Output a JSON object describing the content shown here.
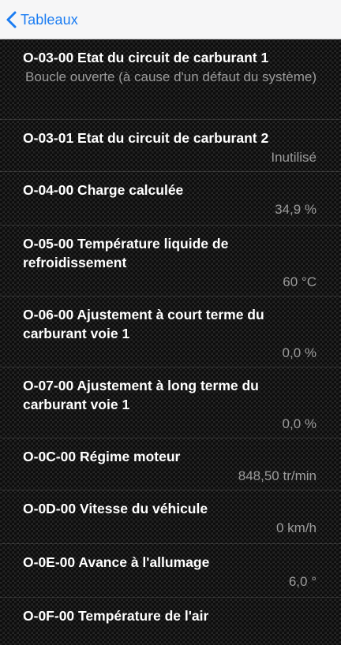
{
  "navbar": {
    "back_label": "Tableaux"
  },
  "rows": [
    {
      "title": "O-03-00 Etat du circuit de carburant 1",
      "value": "Boucle ouverte (à cause d'un défaut du système)"
    },
    {
      "title": "O-03-01 Etat du circuit de carburant 2",
      "value": "Inutilisé"
    },
    {
      "title": "O-04-00 Charge calculée",
      "value": "34,9 %"
    },
    {
      "title": "O-05-00 Température liquide de refroidissement",
      "value": "60 °C"
    },
    {
      "title": "O-06-00 Ajustement à court terme du carburant voie 1",
      "value": "0,0 %"
    },
    {
      "title": "O-07-00 Ajustement à long terme du carburant voie 1",
      "value": "0,0 %"
    },
    {
      "title": "O-0C-00 Régime moteur",
      "value": "848,50 tr/min"
    },
    {
      "title": "O-0D-00 Vitesse du véhicule",
      "value": "0 km/h"
    },
    {
      "title": "O-0E-00 Avance à l'allumage",
      "value": "6,0 °"
    },
    {
      "title": "O-0F-00 Température de l'air",
      "value": ""
    }
  ],
  "colors": {
    "accent": "#1a7cf2",
    "navbar_bg": "#f6f6f7",
    "title_text": "#ffffff",
    "value_text": "#9c9c9c"
  },
  "icons": {
    "back": "chevron-left-icon"
  }
}
